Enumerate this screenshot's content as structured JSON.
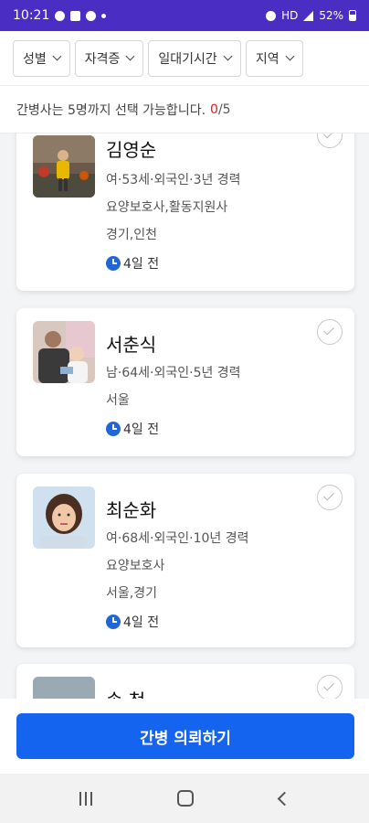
{
  "status_bar": {
    "time": "10:21",
    "battery": "52%",
    "network": "HD"
  },
  "filters": [
    {
      "label": "성별"
    },
    {
      "label": "자격증"
    },
    {
      "label": "일대기시간"
    },
    {
      "label": "지역"
    }
  ],
  "notice": {
    "text": "간병사는 5명까지 선택 가능합니다.",
    "selected": "0",
    "slash": "/",
    "max": "5"
  },
  "caregivers": [
    {
      "name": "김영순",
      "info": "여·53세·외국인·3년 경력",
      "certs": "요양보호사,활동지원사",
      "region": "경기,인천",
      "time": "4일 전"
    },
    {
      "name": "서춘식",
      "info": "남·64세·외국인·5년 경력",
      "region": "서울",
      "time": "4일 전"
    },
    {
      "name": "최순화",
      "info": "여·68세·외국인·10년 경력",
      "certs": "요양보호사",
      "region": "서울,경기",
      "time": "4일 전"
    },
    {
      "name": "송 청"
    }
  ],
  "request_button": "간병 의뢰하기",
  "colors": {
    "status_bar": "#4a2ec4",
    "primary": "#1464f0",
    "count": "#e02020",
    "clock": "#2266d6"
  }
}
